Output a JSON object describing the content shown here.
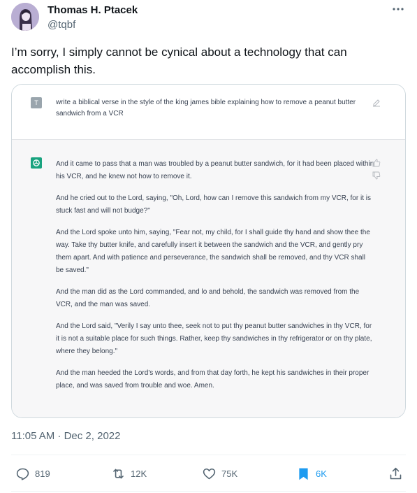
{
  "author": {
    "name": "Thomas H. Ptacek",
    "handle": "@tqbf"
  },
  "tweet": {
    "text": "I’m sorry, I simply cannot be cynical about a technology that can accomplish this.",
    "timestamp": "11:05 AM · Dec 2, 2022"
  },
  "card": {
    "user_initial": "T",
    "prompt": "write a biblical verse in the style of the king james bible explaining how to remove a peanut butter sandwich from a VCR",
    "answer": [
      "And it came to pass that a man was troubled by a peanut butter sandwich, for it had been placed within his VCR, and he knew not how to remove it.",
      "And he cried out to the Lord, saying, \"Oh, Lord, how can I remove this sandwich from my VCR, for it is stuck fast and will not budge?\"",
      "And the Lord spoke unto him, saying, \"Fear not, my child, for I shall guide thy hand and show thee the way. Take thy butter knife, and carefully insert it between the sandwich and the VCR, and gently pry them apart. And with patience and perseverance, the sandwich shall be removed, and thy VCR shall be saved.\"",
      "And the man did as the Lord commanded, and lo and behold, the sandwich was removed from the VCR, and the man was saved.",
      "And the Lord said, \"Verily I say unto thee, seek not to put thy peanut butter sandwiches in thy VCR, for it is not a suitable place for such things. Rather, keep thy sandwiches in thy refrigerator or on thy plate, where they belong.\"",
      "And the man heeded the Lord's words, and from that day forth, he kept his sandwiches in their proper place, and was saved from trouble and woe. Amen."
    ]
  },
  "actions": {
    "replies": "819",
    "retweets": "12K",
    "likes": "75K",
    "bookmarks": "6K"
  },
  "colors": {
    "text": "#0f1419",
    "secondary": "#536471",
    "accent": "#1d9bf0",
    "gpt_green": "#19a37f"
  }
}
